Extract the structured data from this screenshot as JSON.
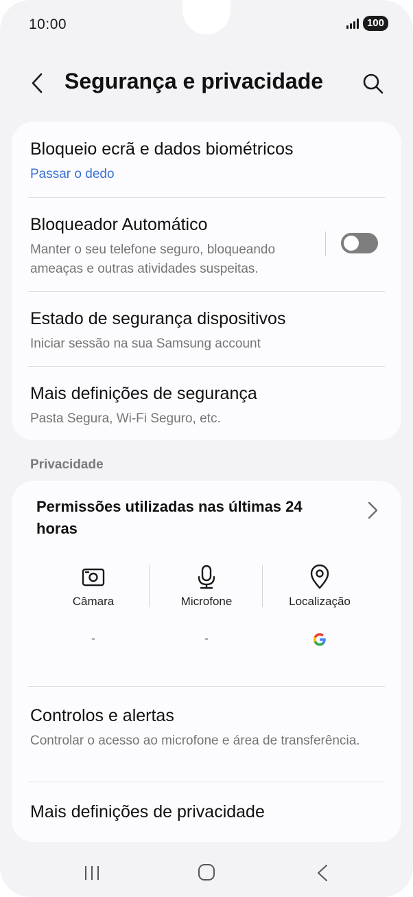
{
  "status_bar": {
    "time": "10:00",
    "battery": "100"
  },
  "header": {
    "title": "Segurança e privacidade"
  },
  "security": {
    "items": [
      {
        "title": "Bloqueio ecrã e dados biométricos",
        "subtitle": "Passar o dedo"
      },
      {
        "title": "Bloqueador Automático",
        "subtitle": "Manter o seu telefone seguro, bloqueando ameaças e outras atividades suspeitas.",
        "toggle": false
      },
      {
        "title": "Estado de segurança dispositivos",
        "subtitle": "Iniciar sessão na sua Samsung account"
      },
      {
        "title": "Mais definições de segurança",
        "subtitle": "Pasta Segura, Wi-Fi Seguro, etc."
      }
    ]
  },
  "privacy": {
    "section_label": "Privacidade",
    "permissions": {
      "title": "Permissões utilizadas nas últimas 24 horas",
      "columns": [
        {
          "label": "Câmara",
          "icon": "camera-icon",
          "value": "-"
        },
        {
          "label": "Microfone",
          "icon": "microphone-icon",
          "value": "-"
        },
        {
          "label": "Localização",
          "icon": "location-icon",
          "value": "google-logo"
        }
      ]
    },
    "items": [
      {
        "title": "Controlos e alertas",
        "subtitle": "Controlar o acesso ao microfone e área de transferência."
      },
      {
        "title": "Mais definições de privacidade"
      }
    ]
  },
  "colors": {
    "link": "#3a6fd6",
    "toggle_off": "#7d7d7d",
    "background": "#f3f3f6"
  }
}
